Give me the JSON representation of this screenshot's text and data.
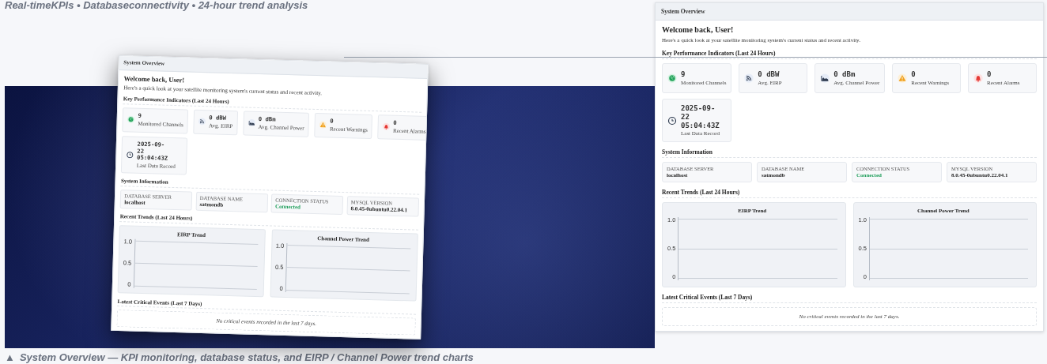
{
  "top_caption": "Real-timeKPIs • Databaseconnectivity • 24-hour trend analysis",
  "showcase": {
    "header_title": "System Overview",
    "welcome": "Welcome back, User!",
    "intro": "Here's a quick look at your satellite monitoring system's current status and recent activity.",
    "kpi_heading": "Key Performance Indicators (Last 24 Hours)",
    "kpis": [
      {
        "kind": "globe",
        "value": "9",
        "label": "Monitored Channels"
      },
      {
        "kind": "feed",
        "value": "0 dBW",
        "label": "Avg. EIRP"
      },
      {
        "kind": "area",
        "value": "0 dBm",
        "label": "Avg. Channel Power"
      },
      {
        "kind": "warning",
        "value": "0",
        "label": "Recent Warnings"
      },
      {
        "kind": "bell",
        "value": "0",
        "label": "Recent Alarms"
      },
      {
        "kind": "clock",
        "value": "2025-09-22 05:04:43Z",
        "label": "Last Data Record"
      }
    ],
    "info_heading": "System Information",
    "info": [
      {
        "kind": "text",
        "label": "DATABASE SERVER",
        "value": "localhost"
      },
      {
        "kind": "text",
        "label": "DATABASE NAME",
        "value": "satmondb"
      },
      {
        "kind": "status",
        "label": "CONNECTION STATUS",
        "value": "Connected"
      },
      {
        "kind": "text",
        "label": "MYSQL VERSION",
        "value": "8.0.45-0ubuntu0.22.04.1"
      }
    ],
    "trends_heading": "Recent Trends (Last 24 Hours)",
    "charts": [
      {
        "title": "EIRP Trend",
        "y_labels": [
          "1.0",
          "0.5",
          "0"
        ]
      },
      {
        "title": "Channel Power Trend",
        "y_labels": [
          "1.0",
          "0.5",
          "0"
        ]
      }
    ],
    "events_heading": "Latest Critical Events (Last 7 Days)",
    "events_empty": "No critical events recorded in the last 7 days."
  },
  "bottom_caption": {
    "icon": "▲",
    "text": "System Overview — KPI monitoring, database status, and EIRP / Channel Power trend charts"
  },
  "dashboard": {
    "header_title": "System Overview",
    "welcome": "Welcome back, User!",
    "intro": "Here's a quick look at your satellite monitoring system's current status and recent activity.",
    "kpi_heading": "Key Performance Indicators (Last 24 Hours)",
    "kpis": [
      {
        "kind": "globe",
        "value": "9",
        "label": "Monitored Channels"
      },
      {
        "kind": "feed",
        "value": "0 dBW",
        "label": "Avg. EIRP"
      },
      {
        "kind": "area",
        "value": "0 dBm",
        "label": "Avg. Channel Power"
      },
      {
        "kind": "warning",
        "value": "0",
        "label": "Recent Warnings"
      },
      {
        "kind": "bell",
        "value": "0",
        "label": "Recent Alarms"
      },
      {
        "kind": "clock",
        "value": "2025-09-22 05:04:43Z",
        "label": "Last Data Record"
      }
    ],
    "info_heading": "System Information",
    "info": [
      {
        "kind": "text",
        "label": "DATABASE SERVER",
        "value": "localhost"
      },
      {
        "kind": "text",
        "label": "DATABASE NAME",
        "value": "satmondb"
      },
      {
        "kind": "status",
        "label": "CONNECTION STATUS",
        "value": "Connected"
      },
      {
        "kind": "text",
        "label": "MYSQL VERSION",
        "value": "8.0.45-0ubuntu0.22.04.1"
      }
    ],
    "trends_heading": "Recent Trends (Last 24 Hours)",
    "charts": [
      {
        "title": "EIRP Trend",
        "y_labels": [
          "1.0",
          "0.5",
          "0"
        ]
      },
      {
        "title": "Channel Power Trend",
        "y_labels": [
          "1.0",
          "0.5",
          "0"
        ]
      }
    ],
    "events_heading": "Latest Critical Events (Last 7 Days)",
    "events_empty": "No critical events recorded in the last 7 days."
  }
}
